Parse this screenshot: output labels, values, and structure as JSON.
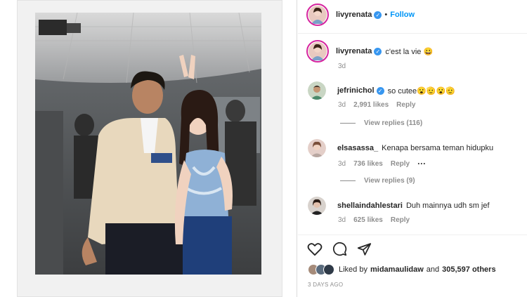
{
  "header": {
    "username": "livyrenata",
    "follow_label": "Follow",
    "dot": "•"
  },
  "caption": {
    "username": "livyrenata",
    "text": "c'est la vie 😀",
    "time": "3d"
  },
  "comments": [
    {
      "username": "jefrinichol",
      "text": "so cutee😮🫡😮🫡",
      "time": "3d",
      "likes": "2,991 likes",
      "reply": "Reply",
      "view_replies": "View replies (116)"
    },
    {
      "username": "elsasassa_",
      "text": "Kenapa bersama teman hidupku",
      "time": "3d",
      "likes": "736 likes",
      "reply": "Reply",
      "more": "···",
      "view_replies": "View replies (9)"
    },
    {
      "username": "shellaindahlestari",
      "text": "Duh mainnya udh sm jef",
      "time": "3d",
      "likes": "625 likes",
      "reply": "Reply"
    }
  ],
  "likes": {
    "prefix": "Liked by",
    "user": "midamaulidaw",
    "and": "and",
    "count": "305,597 others"
  },
  "post_date": "3 DAYS AGO",
  "colors": {
    "accent": "#0095f6",
    "verified": "#3897f0"
  },
  "icons": [
    "heart-icon",
    "comment-icon",
    "share-icon",
    "verified-badge-icon"
  ]
}
